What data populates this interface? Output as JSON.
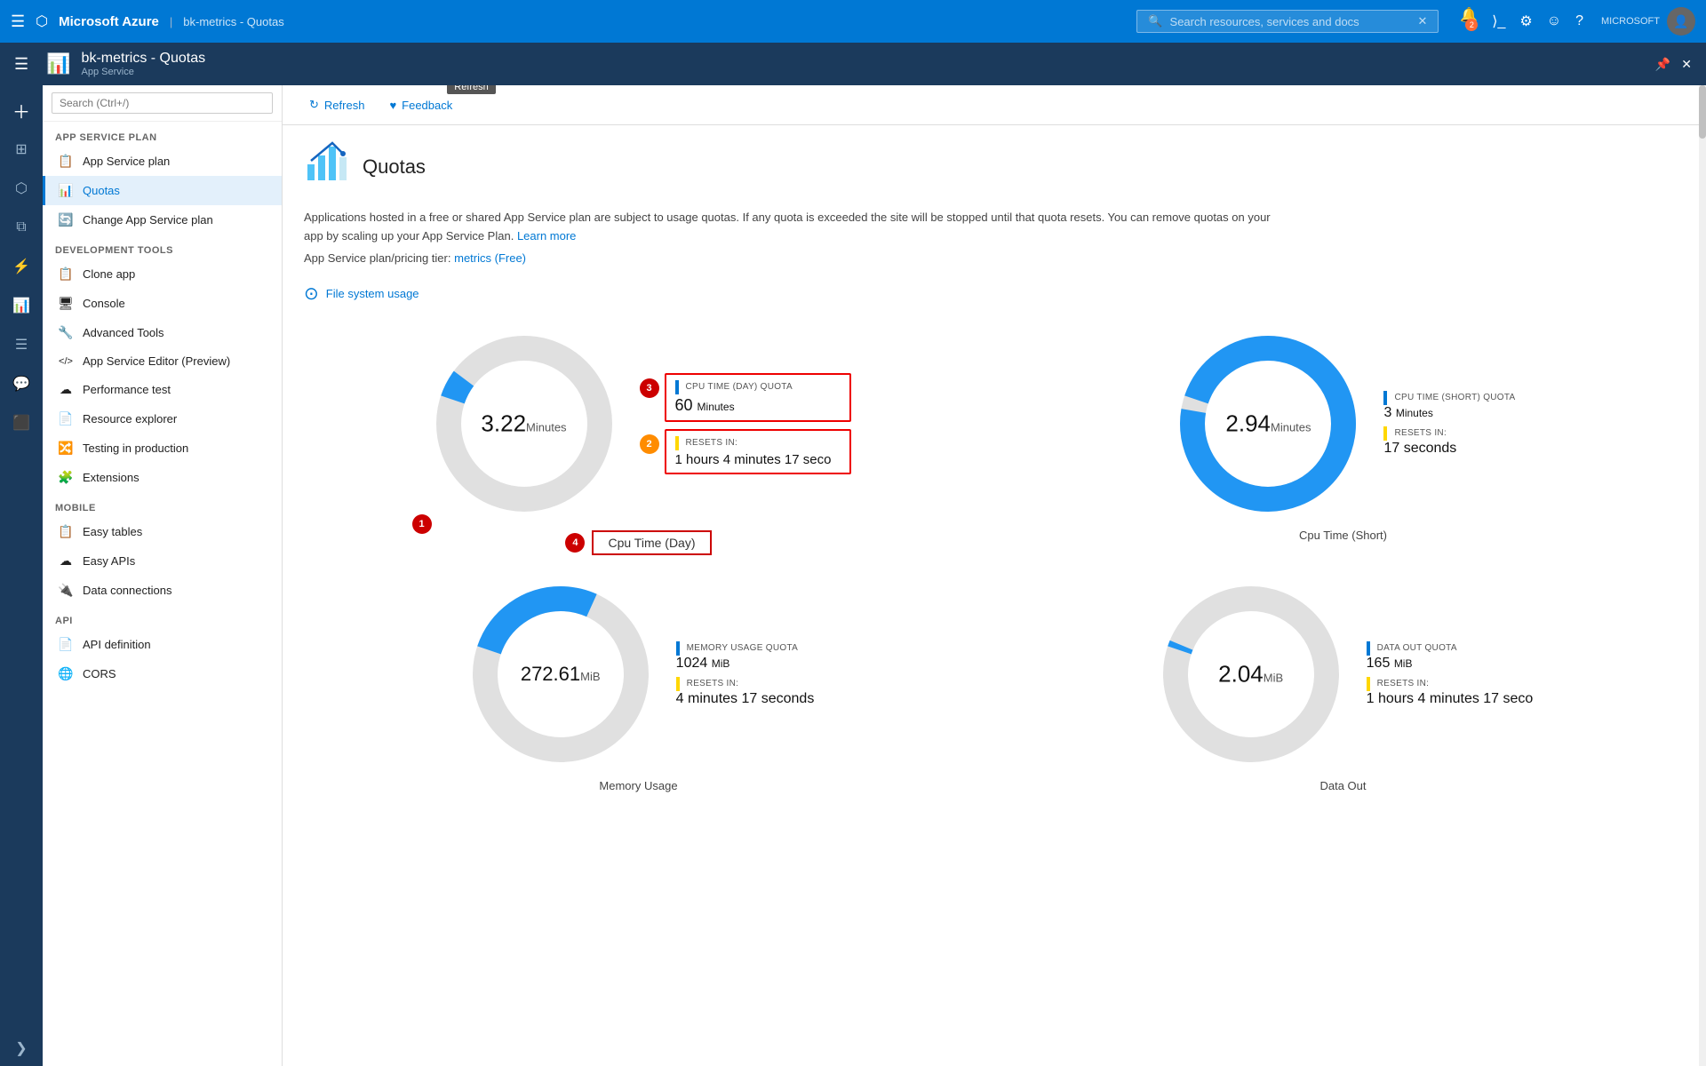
{
  "topbar": {
    "brand": "Microsoft Azure",
    "breadcrumb": "bk-metrics - Quotas",
    "search_placeholder": "Search resources, services and docs",
    "notification_count": "2",
    "user_label": "MICROSOFT"
  },
  "resource_bar": {
    "icon": "📊",
    "title": "bk-metrics - Quotas",
    "subtitle": "App Service"
  },
  "toolbar": {
    "refresh_label": "Refresh",
    "feedback_label": "Feedback",
    "refresh_tooltip": "Refresh"
  },
  "sidebar": {
    "search_placeholder": "Search (Ctrl+/)",
    "sections": [
      {
        "label": "APP SERVICE PLAN",
        "items": [
          {
            "id": "app-service-plan",
            "label": "App Service plan",
            "icon": "📋"
          },
          {
            "id": "quotas",
            "label": "Quotas",
            "icon": "📊",
            "active": true
          },
          {
            "id": "change-app-service-plan",
            "label": "Change App Service plan",
            "icon": "🔄"
          }
        ]
      },
      {
        "label": "DEVELOPMENT TOOLS",
        "items": [
          {
            "id": "clone-app",
            "label": "Clone app",
            "icon": "📋"
          },
          {
            "id": "console",
            "label": "Console",
            "icon": "🖥"
          },
          {
            "id": "advanced-tools",
            "label": "Advanced Tools",
            "icon": "🔧"
          },
          {
            "id": "app-service-editor",
            "label": "App Service Editor (Preview)",
            "icon": "⟨/⟩"
          },
          {
            "id": "performance-test",
            "label": "Performance test",
            "icon": "☁"
          },
          {
            "id": "resource-explorer",
            "label": "Resource explorer",
            "icon": "📄"
          },
          {
            "id": "testing-in-production",
            "label": "Testing in production",
            "icon": "🔀"
          },
          {
            "id": "extensions",
            "label": "Extensions",
            "icon": "🧩"
          }
        ]
      },
      {
        "label": "MOBILE",
        "items": [
          {
            "id": "easy-tables",
            "label": "Easy tables",
            "icon": "📋"
          },
          {
            "id": "easy-apis",
            "label": "Easy APIs",
            "icon": "☁"
          },
          {
            "id": "data-connections",
            "label": "Data connections",
            "icon": "🔌"
          }
        ]
      },
      {
        "label": "API",
        "items": [
          {
            "id": "api-definition",
            "label": "API definition",
            "icon": "📄"
          },
          {
            "id": "cors",
            "label": "CORS",
            "icon": "🌐"
          }
        ]
      }
    ]
  },
  "content": {
    "title": "Quotas",
    "description": "Applications hosted in a free or shared App Service plan are subject to usage quotas. If any quota is exceeded the site will be stopped until that quota resets. You can remove quotas on your app by scaling up your App Service Plan.",
    "learn_more": "Learn more",
    "plan_info": "App Service plan/pricing tier:",
    "plan_link": "metrics (Free)",
    "file_system_link": "File system usage",
    "charts": [
      {
        "id": "cpu-time-day",
        "label": "Cpu Time (Day)",
        "value": "3.22",
        "unit": "Minutes",
        "filled_percent": 5.37,
        "quota_label": "CPU TIME (DAY) QUOTA",
        "quota_value": "60",
        "quota_unit": "Minutes",
        "resets_label": "RESETS IN:",
        "resets_value": "1 hours 4 minutes 17 seco",
        "badge1": "1",
        "badge2": "2",
        "badge3": "3",
        "badge4": "4",
        "color": "#2196f3"
      },
      {
        "id": "cpu-time-short",
        "label": "Cpu Time (Short)",
        "value": "2.94",
        "unit": "Minutes",
        "filled_percent": 98,
        "quota_label": "CPU TIME (SHORT) QUOTA",
        "quota_value": "3",
        "quota_unit": "Minutes",
        "resets_label": "RESETS IN:",
        "resets_value": "17 seconds",
        "color": "#2196f3"
      },
      {
        "id": "memory-usage",
        "label": "Memory Usage",
        "value": "272.61",
        "unit": "MiB",
        "filled_percent": 26.6,
        "quota_label": "MEMORY USAGE QUOTA",
        "quota_value": "1024",
        "quota_unit": "MiB",
        "resets_label": "RESETS IN:",
        "resets_value": "4 minutes 17 seconds",
        "color": "#2196f3"
      },
      {
        "id": "data-out",
        "label": "Data Out",
        "value": "2.04",
        "unit": "MiB",
        "filled_percent": 1.2,
        "quota_label": "DATA OUT QUOTA",
        "quota_value": "165",
        "quota_unit": "MiB",
        "resets_label": "RESETS IN:",
        "resets_value": "1 hours 4 minutes 17 seco",
        "color": "#2196f3"
      }
    ]
  }
}
